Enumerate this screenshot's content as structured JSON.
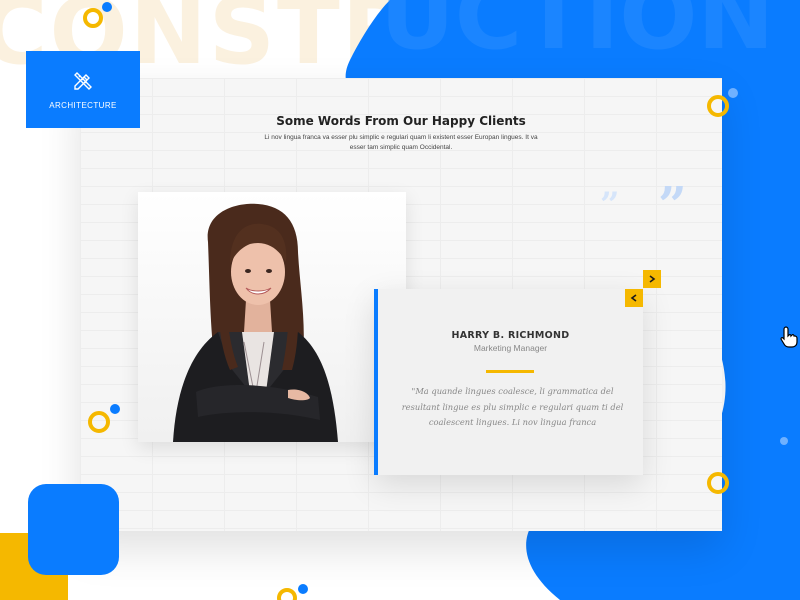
{
  "background": {
    "watermark_text": "CONSTRUCTION",
    "accent_blue": "#0a7cff",
    "accent_yellow": "#f5b800"
  },
  "category_tile": {
    "label": "ARCHITECTURE",
    "icon": "pencil-ruler-icon"
  },
  "section": {
    "title": "Some Words From Our Happy Clients",
    "subtitle": "Li nov lingua franca va esser plu simplic e regulari quam li existent esser Europan lingues. It va esser tam simplic quam Occidental."
  },
  "testimonial": {
    "name": "HARRY B. RICHMOND",
    "role": "Marketing Manager",
    "quote": "\"Ma quande lingues coalesce, li grammatica del resultant lingue es plu simplic e regulari quam ti del coalescent lingues. Li nov lingua franca",
    "quote_mark": "”"
  },
  "navigation": {
    "next_icon": "chevron-right-icon",
    "prev_icon": "chevron-left-icon"
  },
  "cursor": {
    "icon": "hand-pointer-icon"
  }
}
